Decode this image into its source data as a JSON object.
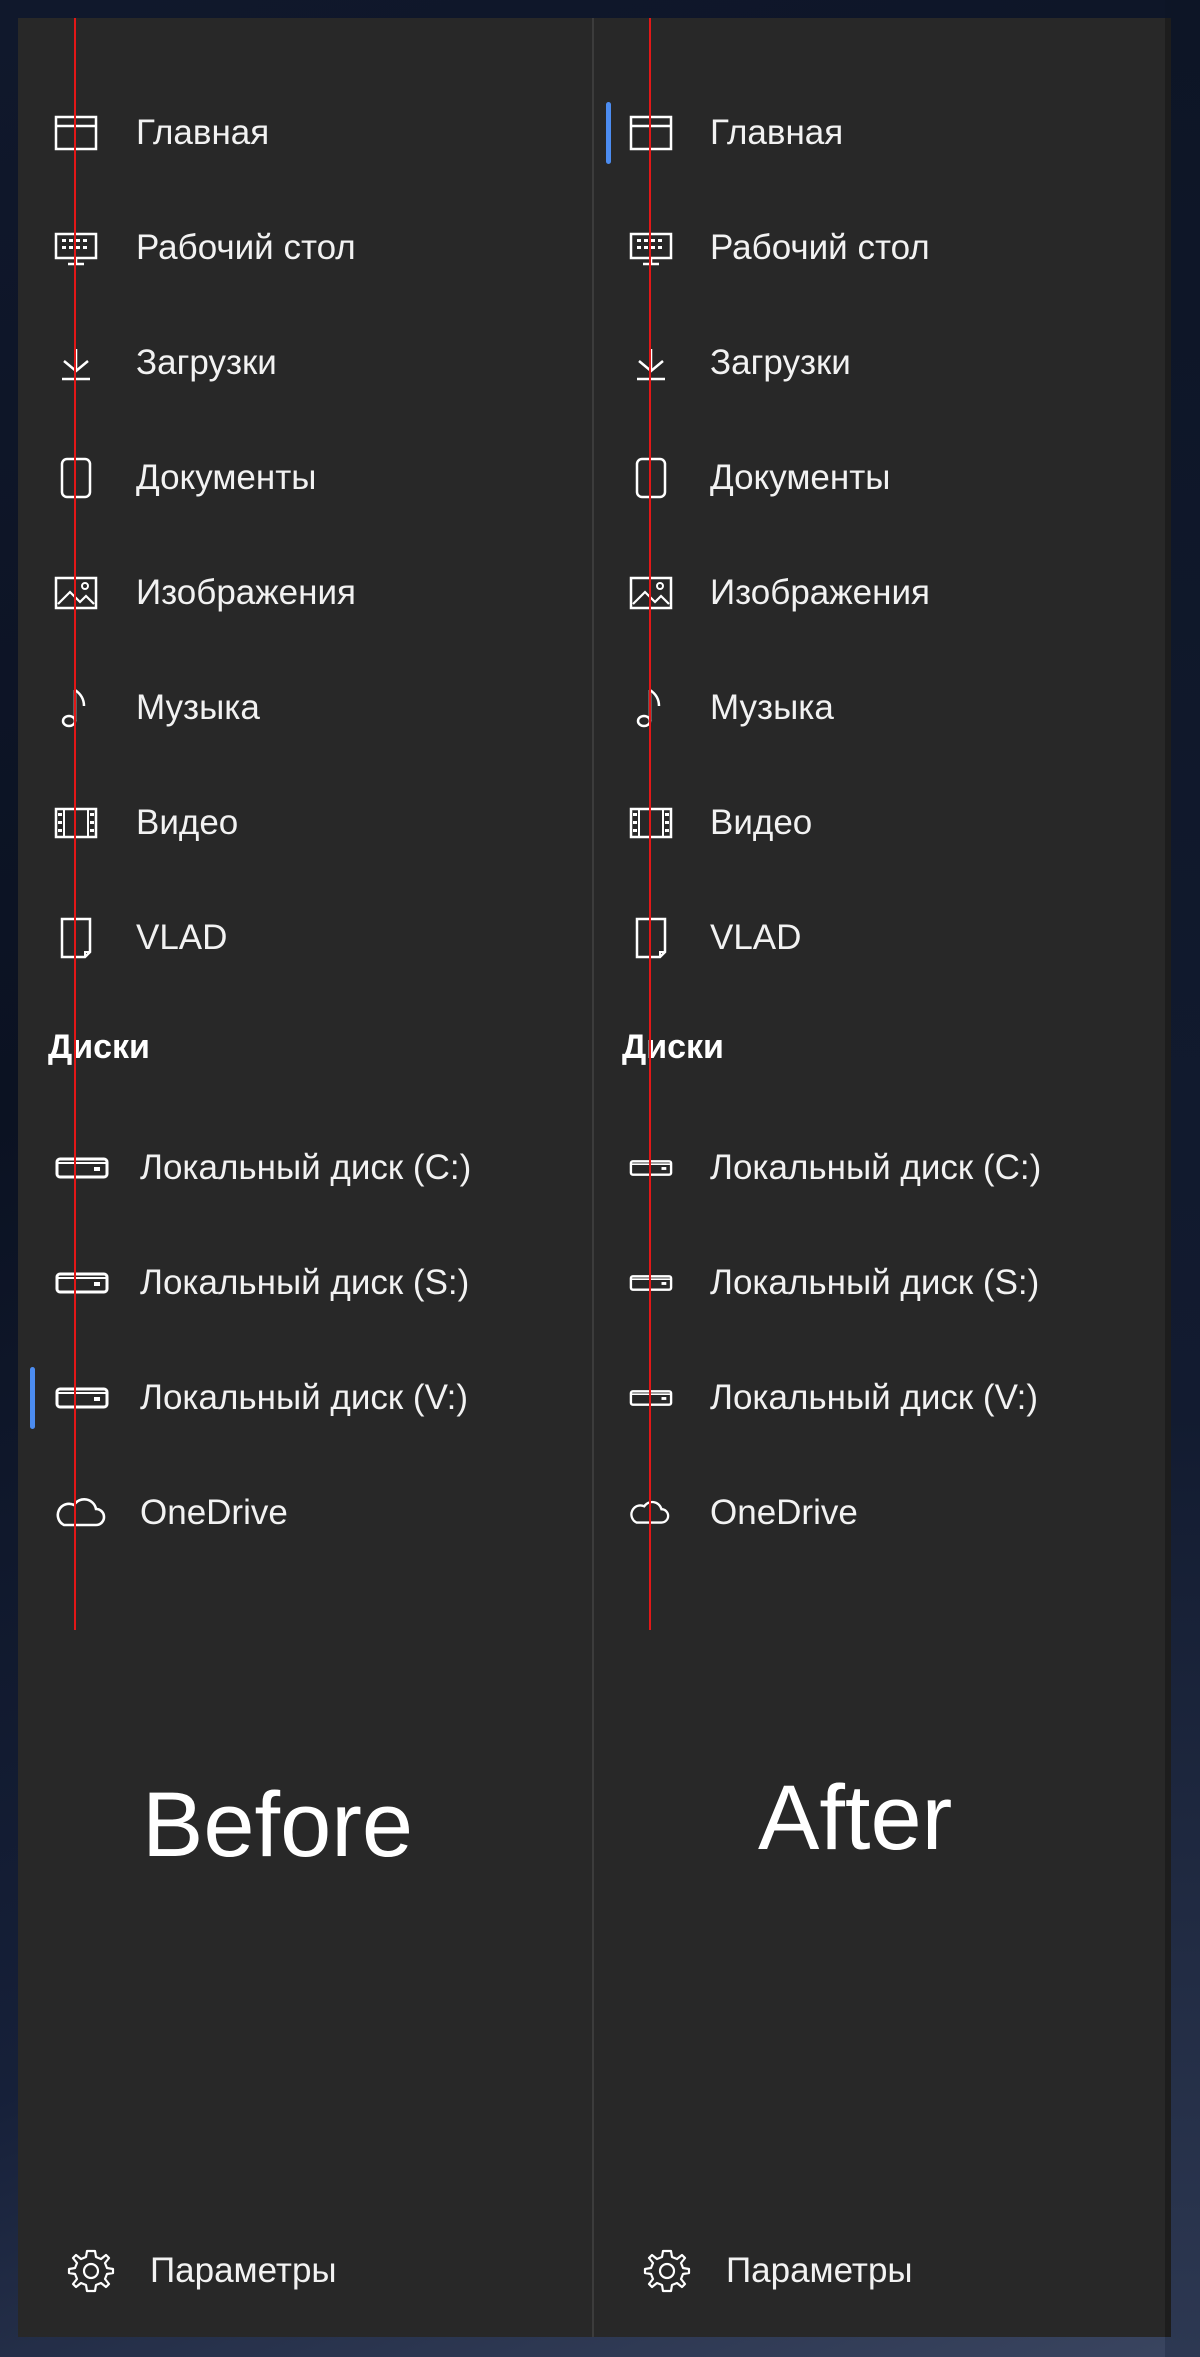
{
  "panels": {
    "before": {
      "caption": "Before",
      "nav_items": [
        {
          "label": "Главная",
          "icon": "home-window-icon"
        },
        {
          "label": "Рабочий стол",
          "icon": "desktop-icon"
        },
        {
          "label": "Загрузки",
          "icon": "download-icon"
        },
        {
          "label": "Документы",
          "icon": "document-icon"
        },
        {
          "label": "Изображения",
          "icon": "pictures-icon"
        },
        {
          "label": "Музыка",
          "icon": "music-note-icon"
        },
        {
          "label": "Видео",
          "icon": "video-film-icon"
        },
        {
          "label": "VLAD",
          "icon": "user-folder-icon"
        }
      ],
      "drives_header": "Диски",
      "drives": [
        {
          "label": "Локальный диск (C:)",
          "icon": "drive-icon"
        },
        {
          "label": "Локальный диск (S:)",
          "icon": "drive-icon"
        },
        {
          "label": "Локальный диск (V:)",
          "icon": "drive-icon",
          "selected": true
        },
        {
          "label": "OneDrive",
          "icon": "cloud-icon"
        }
      ],
      "settings_label": "Параметры"
    },
    "after": {
      "caption": "After",
      "nav_items": [
        {
          "label": "Главная",
          "icon": "home-window-icon",
          "selected": true
        },
        {
          "label": "Рабочий стол",
          "icon": "desktop-icon"
        },
        {
          "label": "Загрузки",
          "icon": "download-icon"
        },
        {
          "label": "Документы",
          "icon": "document-icon"
        },
        {
          "label": "Изображения",
          "icon": "pictures-icon"
        },
        {
          "label": "Музыка",
          "icon": "music-note-icon"
        },
        {
          "label": "Видео",
          "icon": "video-film-icon"
        },
        {
          "label": "VLAD",
          "icon": "user-folder-icon"
        }
      ],
      "drives_header": "Диски",
      "drives": [
        {
          "label": "Локальный диск (C:)",
          "icon": "drive-icon"
        },
        {
          "label": "Локальный диск (S:)",
          "icon": "drive-icon"
        },
        {
          "label": "Локальный диск (V:)",
          "icon": "drive-icon"
        },
        {
          "label": "OneDrive",
          "icon": "cloud-icon"
        }
      ],
      "settings_label": "Параметры"
    }
  },
  "colors": {
    "panel_bg": "#282828",
    "selection_accent": "#4c8cf0",
    "guide_line": "#e21717",
    "text": "#f2f2f2"
  }
}
